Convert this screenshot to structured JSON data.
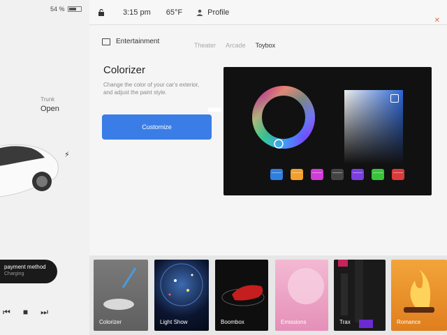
{
  "left": {
    "battery_pct": "54 %",
    "trunk_label": "Trunk",
    "trunk_value": "Open",
    "payment_title": "payment method",
    "payment_sub": "Charging",
    "media": {
      "prev": "⏮",
      "stop": "■",
      "next": "⏭"
    }
  },
  "topbar": {
    "time": "3:15 pm",
    "temperature": "65°F",
    "profile": "Profile"
  },
  "nav": {
    "section": "Entertainment",
    "tabs": [
      {
        "label": "Theater",
        "active": false
      },
      {
        "label": "Arcade",
        "active": false
      },
      {
        "label": "Toybox",
        "active": true
      }
    ]
  },
  "colorizer": {
    "title": "Colorizer",
    "description": "Change the color of your car's exterior, and adjust the paint style.",
    "button": "Customize"
  },
  "picker": {
    "swatches": [
      "#2f7fe0",
      "#f2a02b",
      "#d13bd8",
      "#444444",
      "#7b3ee0",
      "#38c43a",
      "#d93a3a"
    ]
  },
  "apps": [
    {
      "label": "Colorizer"
    },
    {
      "label": "Light Show"
    },
    {
      "label": "Boombox"
    },
    {
      "label": "Emissions"
    },
    {
      "label": "Trax"
    },
    {
      "label": "Romance"
    }
  ]
}
